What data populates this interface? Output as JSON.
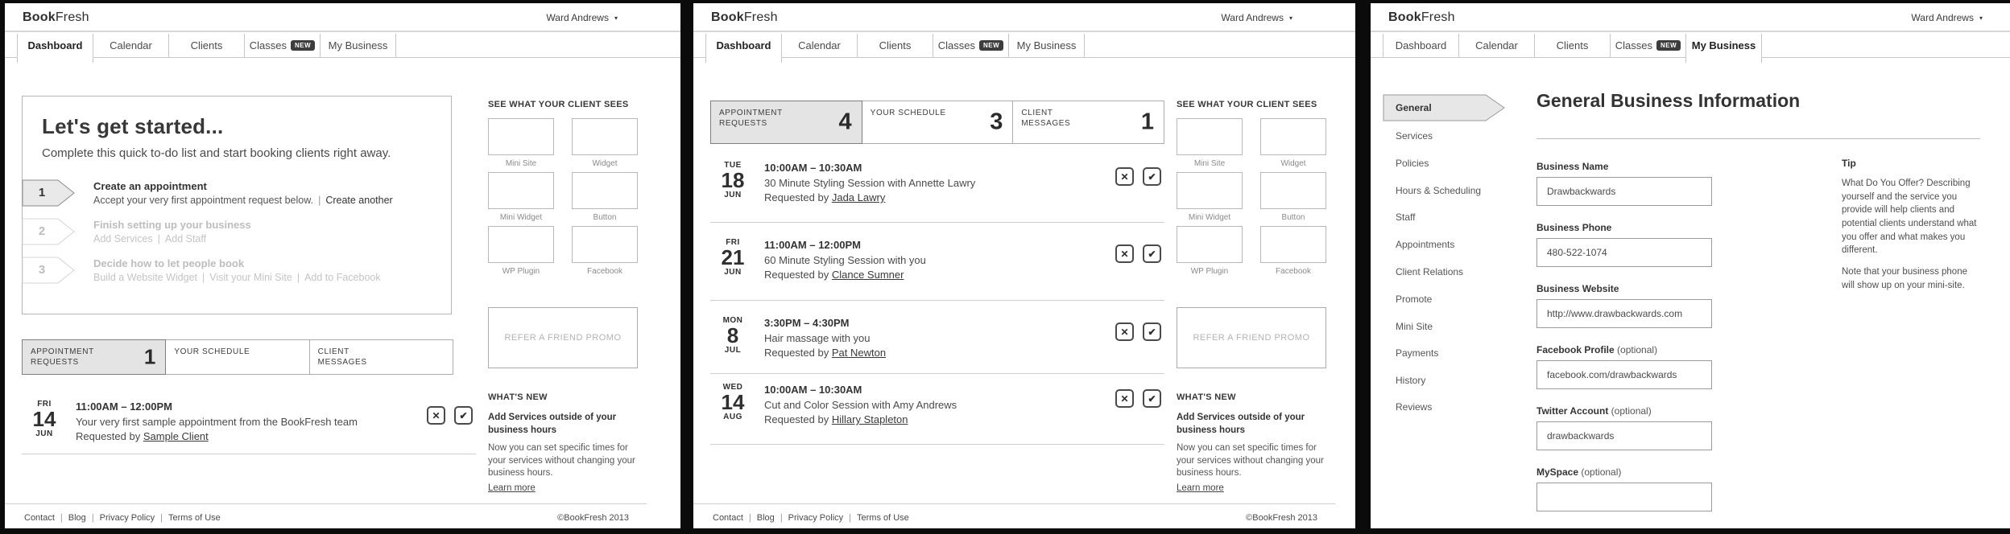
{
  "brand": {
    "logo_bold": "Book",
    "logo_light": "Fresh"
  },
  "user": {
    "name": "Ward Andrews",
    "caret": "▾"
  },
  "tabs": {
    "items": [
      "Dashboard",
      "Calendar",
      "Clients",
      "Classes",
      "My Business"
    ],
    "new_badge": "NEW"
  },
  "sep": "|",
  "icons": {
    "decline": "✕",
    "accept": "✔"
  },
  "footer": {
    "links": [
      "Contact",
      "Blog",
      "Privacy Policy",
      "Terms of Use"
    ],
    "copyright": "©BookFresh 2013"
  },
  "dashboard1": {
    "getting_started": {
      "title": "Let's get started...",
      "subtitle": "Complete this quick to-do list and start booking clients right away.",
      "steps": [
        {
          "num": "1",
          "title": "Create an appointment",
          "desc": "Accept your very first appointment request below.",
          "links": [
            "Create another"
          ]
        },
        {
          "num": "2",
          "title": "Finish setting up your business",
          "links": [
            "Add Services",
            "Add Staff"
          ]
        },
        {
          "num": "3",
          "title": "Decide how to let people book",
          "links": [
            "Build a Website Widget",
            "Visit your Mini Site",
            "Add to Facebook"
          ]
        }
      ]
    },
    "stats": [
      {
        "label": "APPOINTMENT REQUESTS",
        "count": "1"
      },
      {
        "label": "YOUR SCHEDULE",
        "count": ""
      },
      {
        "label": "CLIENT MESSAGES",
        "count": ""
      }
    ],
    "appointments": [
      {
        "day": "FRI",
        "date": "14",
        "month": "JUN",
        "time": "11:00AM – 12:00PM",
        "desc": "Your very first sample appointment from the BookFresh team",
        "requested_by": "Requested by ",
        "client": "Sample Client"
      }
    ]
  },
  "dashboard2": {
    "stats": [
      {
        "label": "APPOINTMENT REQUESTS",
        "count": "4"
      },
      {
        "label": "YOUR SCHEDULE",
        "count": "3"
      },
      {
        "label": "CLIENT MESSAGES",
        "count": "1"
      }
    ],
    "appointments": [
      {
        "day": "TUE",
        "date": "18",
        "month": "JUN",
        "time": "10:00AM – 10:30AM",
        "desc": "30 Minute Styling Session with Annette Lawry",
        "requested_by": "Requested by ",
        "client": "Jada Lawry"
      },
      {
        "day": "FRI",
        "date": "21",
        "month": "JUN",
        "time": "11:00AM – 12:00PM",
        "desc": "60 Minute Styling Session with you",
        "requested_by": "Requested by ",
        "client": "Clance Sumner"
      },
      {
        "day": "MON",
        "date": "8",
        "month": "JUL",
        "time": "3:30PM – 4:30PM",
        "desc": "Hair massage with you",
        "requested_by": "Requested by ",
        "client": "Pat Newton"
      },
      {
        "day": "WED",
        "date": "14",
        "month": "AUG",
        "time": "10:00AM – 10:30AM",
        "desc": "Cut and Color Session with Amy Andrews",
        "requested_by": "Requested by ",
        "client": "Hillary Stapleton"
      }
    ]
  },
  "sidebar": {
    "client_sees_heading": "SEE WHAT YOUR CLIENT SEES",
    "thumbnails": [
      "Mini Site",
      "Widget",
      "Mini Widget",
      "Button",
      "WP Plugin",
      "Facebook"
    ],
    "promo_label": "REFER A FRIEND PROMO",
    "whats_new": {
      "heading": "WHAT'S NEW",
      "title": "Add Services outside of your business hours",
      "body": "Now you can set specific times for your services without changing your business hours.",
      "link": "Learn more"
    }
  },
  "business": {
    "nav": [
      "General",
      "Services",
      "Policies",
      "Hours & Scheduling",
      "Staff",
      "Appointments",
      "Client Relations",
      "Promote",
      "Mini Site",
      "Payments",
      "History",
      "Reviews"
    ],
    "title": "General Business Information",
    "fields": [
      {
        "label": "Business Name",
        "optional": "",
        "value": "Drawbackwards"
      },
      {
        "label": "Business Phone",
        "optional": "",
        "value": "480-522-1074"
      },
      {
        "label": "Business Website",
        "optional": "",
        "value": "http://www.drawbackwards.com"
      },
      {
        "label": "Facebook Profile",
        "optional": " (optional)",
        "value": "facebook.com/drawbackwards"
      },
      {
        "label": "Twitter Account",
        "optional": " (optional)",
        "value": "drawbackwards"
      },
      {
        "label": "MySpace",
        "optional": " (optional)",
        "value": ""
      }
    ],
    "tip": {
      "heading": "Tip",
      "p1": "What Do You Offer? Describing yourself and the service you provide will help clients and potential clients understand what you offer and what makes you different.",
      "p2": "Note that your business phone will show up on your mini-site."
    }
  },
  "colors": {
    "accent_dark": "#3d3d3d",
    "active_bg": "#e4e4e4",
    "border": "#c7c7c7",
    "text": "#3a3a3a",
    "muted": "#9b9b9b"
  }
}
